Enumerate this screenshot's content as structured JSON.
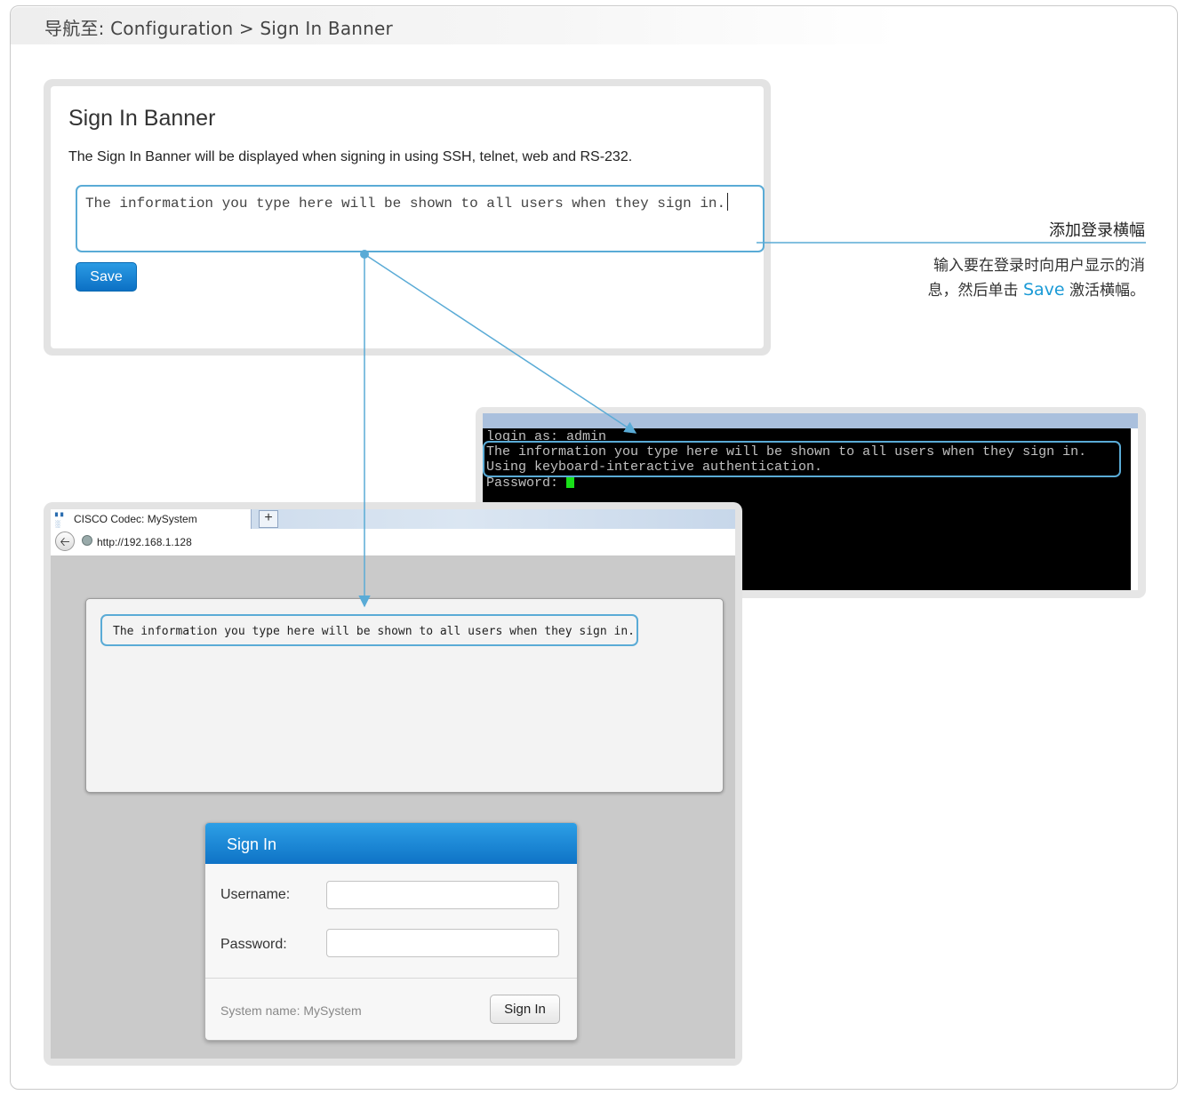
{
  "nav": {
    "label": "导航至: Configuration > Sign In Banner"
  },
  "config": {
    "title": "Sign In Banner",
    "description": "The Sign In Banner will be displayed when signing in using SSH, telnet, web and RS-232.",
    "banner_value": "The information you type here will be shown to all users when they sign in.",
    "save_label": "Save"
  },
  "annotation": {
    "title": "添加登录横幅",
    "body_line1": "输入要在登录时向用户显示的消",
    "body_line2_prefix": "息，然后单击 ",
    "body_highlight": "Save",
    "body_line2_suffix": " 激活横幅。"
  },
  "terminal": {
    "lines": [
      "login as: admin",
      "The information you type here will be shown to all users when they sign in.",
      "Using keyboard-interactive authentication.",
      "Password: "
    ]
  },
  "browser": {
    "tab_label": "CISCO Codec: MySystem",
    "new_tab": "+",
    "url": "http://192.168.1.128",
    "banner_text": "The information you type here will be shown to all users when they sign in.",
    "signin": {
      "title": "Sign In",
      "username_label": "Username:",
      "password_label": "Password:",
      "system_name": "System name: MySystem",
      "button": "Sign In"
    }
  },
  "colors": {
    "accent": "#5aabd6",
    "button_blue": "#0c70c4",
    "terminal_cursor": "#19e019"
  },
  "icons": {
    "back": "back-arrow-icon",
    "globe": "globe-icon",
    "favicon": "cisco-logo-icon"
  }
}
